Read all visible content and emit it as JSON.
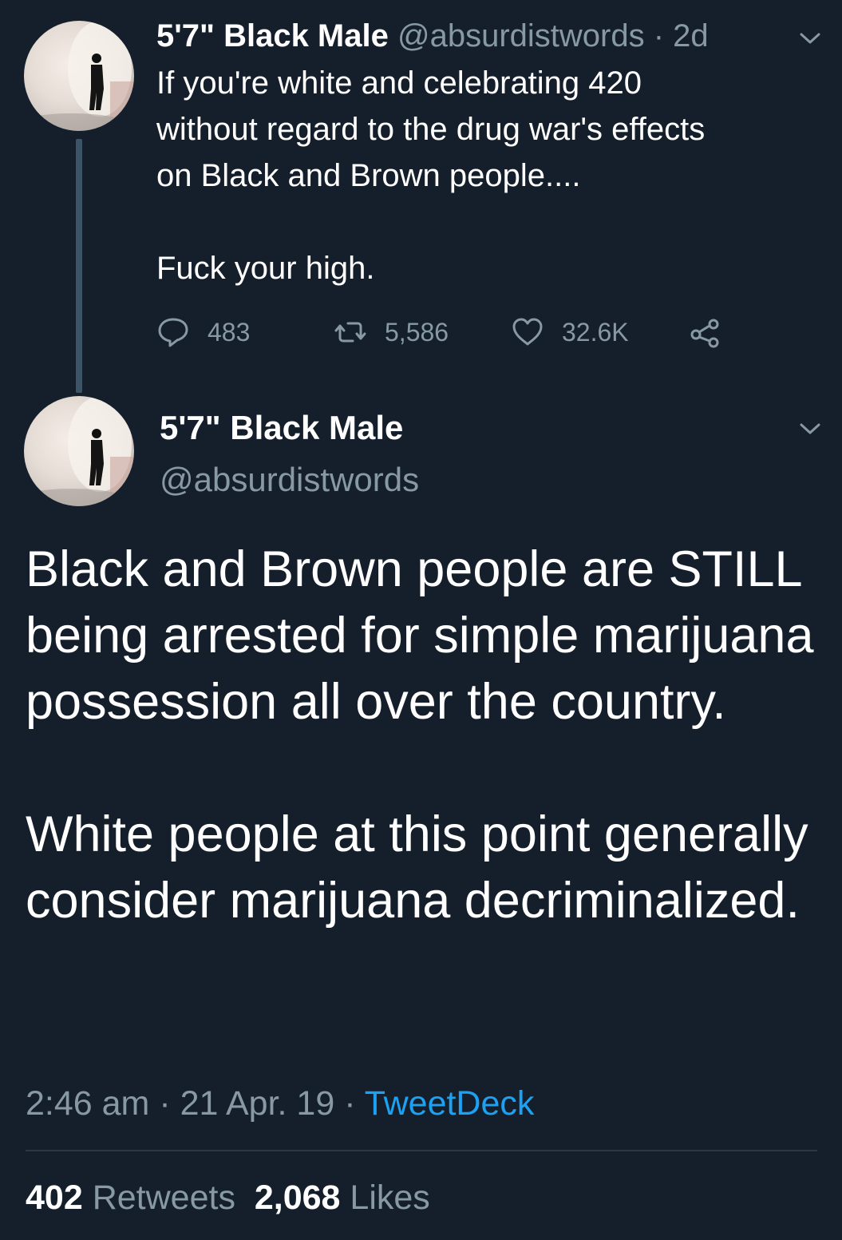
{
  "tweet1": {
    "display_name": "5'7\" Black Male",
    "handle": "@absurdistwords",
    "separator": "·",
    "time_ago": "2d",
    "body_lines": [
      "If you're white and celebrating 420",
      "without regard to the drug war's effects",
      "on Black and Brown people....",
      "Fuck your high."
    ],
    "actions": {
      "replies": "483",
      "retweets": "5,586",
      "likes": "32.6K"
    }
  },
  "tweet2": {
    "display_name": "5'7\" Black Male",
    "handle": "@absurdistwords",
    "paragraph1": "Black and Brown people are STILL being arrested for simple marijuana possession all over the country.",
    "paragraph2": "White people at this point generally consider marijuana decriminalized.",
    "time": "2:46 am",
    "sep1": " · ",
    "date": "21 Apr. 19",
    "sep2": " · ",
    "source": "TweetDeck",
    "retweet_count": "402",
    "retweet_label": "Retweets",
    "like_count": "2,068",
    "like_label": "Likes"
  },
  "colors": {
    "background": "#151f2b",
    "primary_text": "#ffffff",
    "secondary_text": "#8899a6",
    "link": "#1da1f2",
    "thread_line": "#3d5466"
  }
}
